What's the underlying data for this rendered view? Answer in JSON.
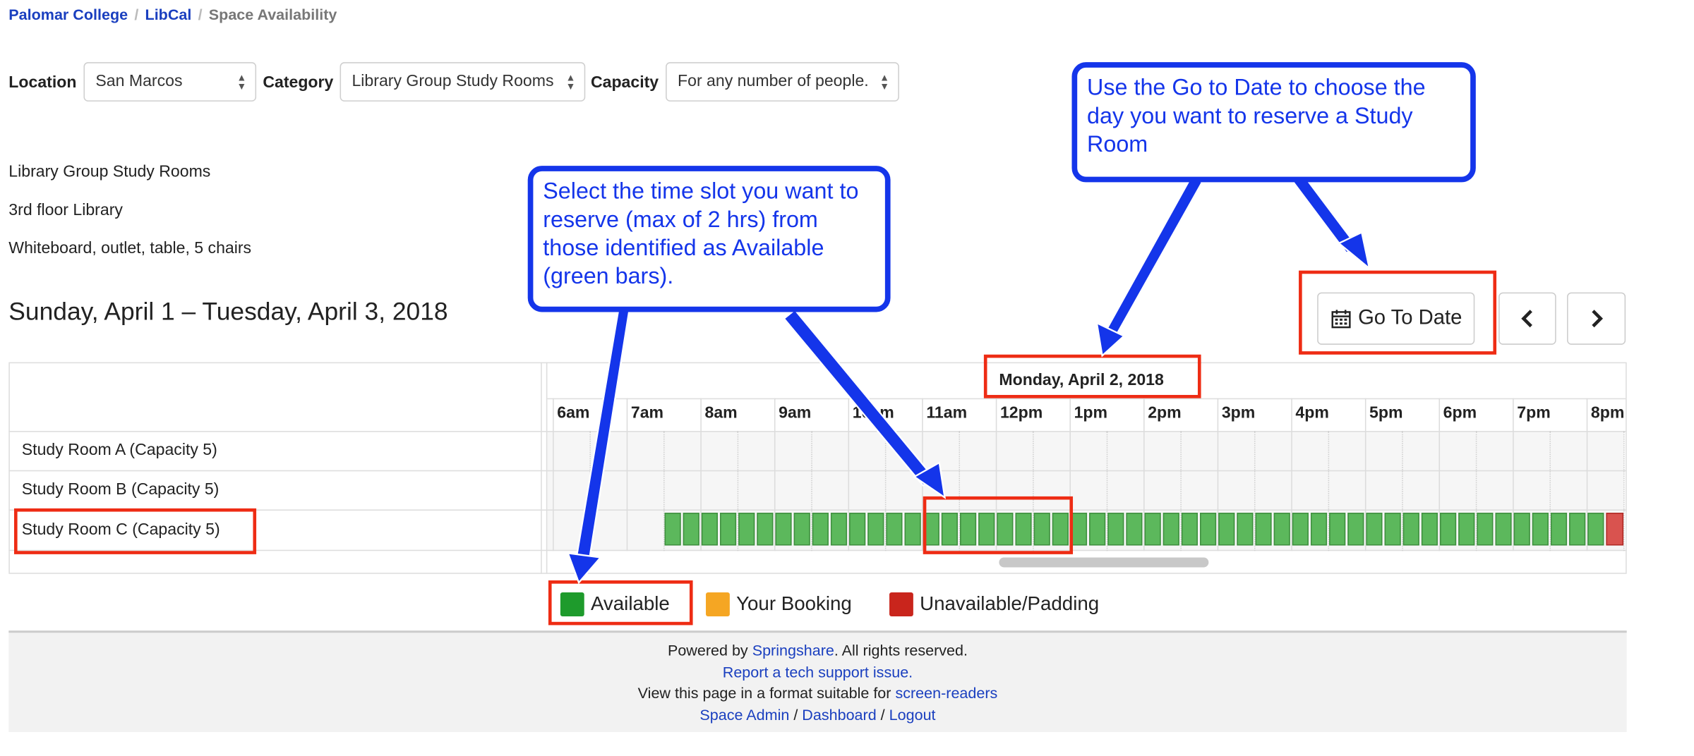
{
  "breadcrumb": [
    "Palomar College",
    "LibCal",
    "Space Availability"
  ],
  "filters": {
    "location_label": "Location",
    "location_value": "San Marcos",
    "category_label": "Category",
    "category_value": "Library Group Study Rooms",
    "capacity_label": "Capacity",
    "capacity_value": "For any number of people."
  },
  "info": {
    "name": "Library Group Study Rooms",
    "location": "3rd floor Library",
    "features": "Whiteboard, outlet, table, 5 chairs"
  },
  "date_range_title": "Sunday, April 1 – Tuesday, April 3, 2018",
  "go_to_date_label": "Go To Date",
  "prev_icon": "chevron-left-icon",
  "next_icon": "chevron-right-icon",
  "calendar_icon": "calendar-icon",
  "grid": {
    "date_header": "Monday, April 2, 2018",
    "hours": [
      "6am",
      "7am",
      "8am",
      "9am",
      "10am",
      "11am",
      "12pm",
      "1pm",
      "2pm",
      "3pm",
      "4pm",
      "5pm",
      "6pm",
      "7pm",
      "8pm"
    ],
    "rooms": [
      {
        "name": "Study Room A (Capacity 5)"
      },
      {
        "name": "Study Room B (Capacity 5)"
      },
      {
        "name": "Study Room C (Capacity 5)"
      }
    ]
  },
  "legend": [
    {
      "label": "Available",
      "color": "#1e9b2c"
    },
    {
      "label": "Your Booking",
      "color": "#f5a623"
    },
    {
      "label": "Unavailable/Padding",
      "color": "#c9251c"
    }
  ],
  "footer": {
    "powered_by_prefix": "Powered by ",
    "powered_by_link": "Springshare",
    "powered_by_suffix": ". All rights reserved.",
    "report_link": "Report a tech support issue.",
    "view_prefix": "View this page in a format suitable for ",
    "view_link": "screen-readers",
    "admin_links": [
      "Space Admin",
      "Dashboard",
      "Logout"
    ],
    "admin_separator": " / "
  },
  "callouts": {
    "time_slot": "Select the time slot you want to reserve (max of 2 hrs) from those identified as Available (green bars).",
    "go_to_date": "Use the Go to Date to choose the day you want to reserve a Study Room"
  },
  "colors": {
    "link": "#1a3fbf",
    "available_slot": "#5cb85c",
    "unavailable_slot": "#d9534f",
    "annotation_blue": "#1435ea",
    "annotation_red": "#ee2c14"
  }
}
